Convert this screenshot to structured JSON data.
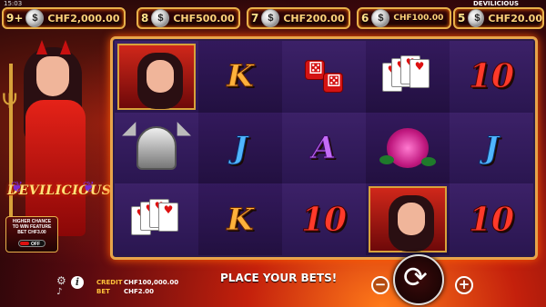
{
  "status": {
    "clock": "15:03",
    "game_name": "DEVILICIOUS"
  },
  "jackpots": [
    {
      "count": "9+",
      "amount": "CHF2,000.00"
    },
    {
      "count": "8",
      "amount": "CHF500.00"
    },
    {
      "count": "7",
      "amount": "CHF200.00"
    },
    {
      "count": "6",
      "amount": "CHF100.00"
    },
    {
      "count": "5",
      "amount": "CHF20.00"
    }
  ],
  "logo": {
    "text": "DEVILICIOUS"
  },
  "feature": {
    "line1": "HIGHER CHANCE",
    "line2": "TO WIN FEATURE",
    "line3": "BET CHF3.00",
    "toggle_state": "OFF"
  },
  "reels": {
    "columns": [
      [
        "wild-devil",
        "silver-bell",
        "playing-cards"
      ],
      [
        "K",
        "J",
        "K"
      ],
      [
        "red-dice",
        "A",
        "10"
      ],
      [
        "playing-cards",
        "rose",
        "wild-devil"
      ],
      [
        "10",
        "J",
        "10"
      ]
    ]
  },
  "balances": {
    "credit_label": "CREDIT",
    "credit_value": "CHF100,000.00",
    "bet_label": "BET",
    "bet_value": "CHF2.00"
  },
  "message": "PLACE YOUR BETS!",
  "controls": {
    "minus": "−",
    "plus": "+"
  },
  "colors": {
    "gold": "#e8b14a",
    "accent_red": "#d41313",
    "reel_bg": "#2b1a4a"
  }
}
